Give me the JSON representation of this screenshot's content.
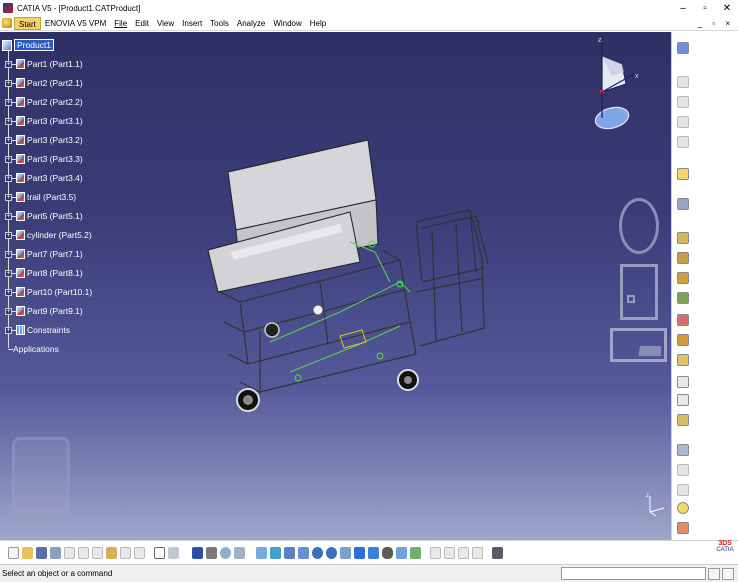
{
  "window": {
    "title": "CATIA V5 - [Product1.CATProduct]",
    "controls": {
      "minimize": "–",
      "restore": "▫",
      "close": "✕"
    },
    "mdi_controls": "_ ▫ ×"
  },
  "menu": {
    "items": [
      "Start",
      "ENOVIA V5 VPM",
      "File",
      "Edit",
      "View",
      "Insert",
      "Tools",
      "Analyze",
      "Window",
      "Help"
    ],
    "active": "Start"
  },
  "tree": {
    "root": "Product1",
    "children": [
      "Part1 (Part1.1)",
      "Part2 (Part2.1)",
      "Part2 (Part2.2)",
      "Part3 (Part3.1)",
      "Part3 (Part3.2)",
      "Part3 (Part3.3)",
      "Part3 (Part3.4)",
      "trail (Part3.5)",
      "Part5 (Part5.1)",
      "cylinder (Part5.2)",
      "Part7 (Part7.1)",
      "Part8 (Part8.1)",
      "Part10 (Part10.1)",
      "Part9 (Part9.1)"
    ],
    "constraints": "Constraints",
    "applications": "Applications"
  },
  "compass": {
    "x_label": "x",
    "y_label": "y",
    "z_label": "z"
  },
  "axis_mini": {
    "z": "z",
    "x": "x"
  },
  "status": {
    "message": "Select an object or a command"
  },
  "brand": {
    "mark": "3DS",
    "name": "CATIA"
  },
  "colors": {
    "background_top": "#2f3165",
    "background_bottom": "#9fa6cb",
    "tree_root_highlight": "#2a5cc8",
    "start_menu_active": "#f5d36a",
    "constraint_green": "#55d64a",
    "model_grey": "#c7c7cc"
  }
}
